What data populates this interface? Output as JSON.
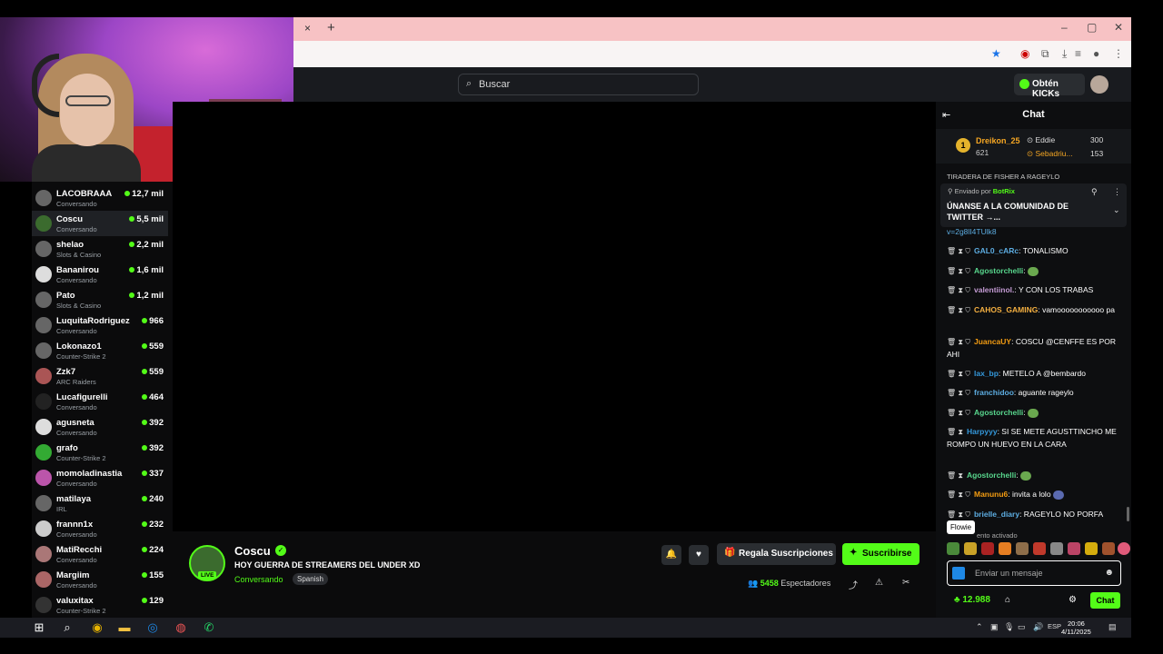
{
  "browser": {
    "tab_close": "×",
    "tab_new": "+",
    "win_controls": [
      "–",
      "▢",
      "✕"
    ]
  },
  "header": {
    "search_placeholder": "Buscar",
    "kicks_label": "Obtén KICKs"
  },
  "sidebar": {
    "items": [
      {
        "name": "LACOBRAAA",
        "category": "Conversando",
        "viewers": "12,7 mil"
      },
      {
        "name": "Coscu",
        "category": "Conversando",
        "viewers": "5,5 mil"
      },
      {
        "name": "shelao",
        "category": "Slots & Casino",
        "viewers": "2,2 mil"
      },
      {
        "name": "Bananirou",
        "category": "Conversando",
        "viewers": "1,6 mil"
      },
      {
        "name": "Pato",
        "category": "Slots & Casino",
        "viewers": "1,2 mil"
      },
      {
        "name": "LuquitaRodriguez",
        "category": "Conversando",
        "viewers": "966"
      },
      {
        "name": "Lokonazo1",
        "category": "Counter-Strike 2",
        "viewers": "559"
      },
      {
        "name": "Zzk7",
        "category": "ARC Raiders",
        "viewers": "559"
      },
      {
        "name": "Lucafigurelli",
        "category": "Conversando",
        "viewers": "464"
      },
      {
        "name": "agusneta",
        "category": "Conversando",
        "viewers": "392"
      },
      {
        "name": "grafo",
        "category": "Counter-Strike 2",
        "viewers": "392"
      },
      {
        "name": "momoladinastia",
        "category": "Conversando",
        "viewers": "337"
      },
      {
        "name": "matilaya",
        "category": "IRL",
        "viewers": "240"
      },
      {
        "name": "frannn1x",
        "category": "Conversando",
        "viewers": "232"
      },
      {
        "name": "MatiRecchi",
        "category": "Conversando",
        "viewers": "224"
      },
      {
        "name": "Margiim",
        "category": "Conversando",
        "viewers": "155"
      },
      {
        "name": "valuxitax",
        "category": "Counter-Strike 2",
        "viewers": "129"
      }
    ]
  },
  "stream": {
    "streamer": "Coscu",
    "live": "LIVE",
    "title": "HOY GUERRA DE STREAMERS DEL UNDER XD",
    "category": "Conversando",
    "language": "Spanish",
    "gift_label": "Regala Suscripciones",
    "subscribe_label": "Suscribirse",
    "viewers_count": "5458",
    "viewers_label": "Espectadores"
  },
  "chat": {
    "title": "Chat",
    "leaderboard": {
      "first": {
        "rank": "1",
        "name": "Dreikon_25",
        "amount": "621"
      },
      "second": {
        "name": "Eddie",
        "amount": "300"
      },
      "third": {
        "name": "Sebadriu...",
        "amount": "153"
      }
    },
    "top_cut": "TIRADERA DE FISHER A RAGEYLO",
    "pinned": {
      "by_prefix": "Enviado por",
      "by_user": "BotRix",
      "text": "ÚNANSE A LA COMUNIDAD DE TWITTER →..."
    },
    "link_cut": "v=2g8lI4TUlk8",
    "messages": [
      {
        "user": "GAL0_cARc",
        "color": "#5dade2",
        "text": ": TONALISMO"
      },
      {
        "user": "Agostorchelli",
        "color": "#58d68d",
        "text": ":"
      },
      {
        "user": "valentiinol.",
        "color": "#c39bd3",
        "text": ": Y CON LOS TRABAS"
      },
      {
        "user": "CAHOS_GAMING",
        "color": "#f5b041",
        "text": ": vamooooooooooo pa"
      },
      {
        "user": "JuancaUY",
        "color": "#f39c12",
        "text": ": COSCU @CENFFE ES POR AHI"
      },
      {
        "user": "lax_bp",
        "color": "#3498db",
        "text": ": METELO A @bembardo"
      },
      {
        "user": "franchidoo",
        "color": "#5dade2",
        "text": ": aguante rageylo"
      },
      {
        "user": "Agostorchelli",
        "color": "#58d68d",
        "text": ":"
      },
      {
        "user": "Harpyyy",
        "color": "#3498db",
        "text": ": SI SE METE AGUSTTINCHO ME ROMPO UN HUEVO EN LA CARA"
      },
      {
        "user": "Agostorchelli",
        "color": "#58d68d",
        "text": ":"
      },
      {
        "user": "Manunu6",
        "color": "#f39c12",
        "text": ": invita a lolo"
      },
      {
        "user": "brielle_diary",
        "color": "#5dade2",
        "text": ": RAGEYLO NO PORFA"
      }
    ],
    "tooltip": "Flowie",
    "mode_text": "ento activado",
    "input_placeholder": "Enviar un mensaje",
    "points": "12.988",
    "chat_button": "Chat"
  },
  "taskbar": {
    "time": "20:06",
    "date": "4/11/2025",
    "lang": "ESP"
  },
  "colors": {
    "accent": "#53fc18",
    "background": "#0b0b0c",
    "tab_pink": "#f7c2c4"
  }
}
